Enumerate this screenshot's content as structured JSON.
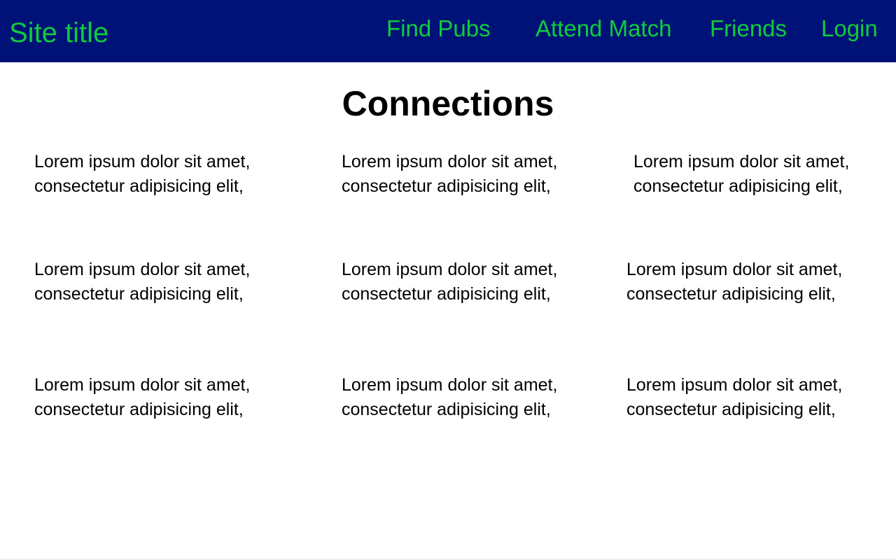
{
  "header": {
    "site_title": "Site title",
    "nav": [
      "Find Pubs",
      "Attend Match",
      "Friends",
      "Login"
    ]
  },
  "page": {
    "title": "Connections"
  },
  "connections": [
    {
      "line1": "Lorem ipsum dolor sit amet,",
      "line2": "consectetur adipisicing elit,"
    },
    {
      "line1": "Lorem ipsum dolor sit amet,",
      "line2": "consectetur adipisicing elit,"
    },
    {
      "line1": "Lorem ipsum dolor sit amet,",
      "line2": "consectetur adipisicing elit,"
    },
    {
      "line1": "Lorem ipsum dolor sit amet,",
      "line2": "consectetur adipisicing elit,"
    },
    {
      "line1": "Lorem ipsum dolor sit amet,",
      "line2": "consectetur adipisicing elit,"
    },
    {
      "line1": "Lorem ipsum dolor sit amet,",
      "line2": "consectetur adipisicing elit,"
    },
    {
      "line1": "Lorem ipsum dolor sit amet,",
      "line2": "consectetur adipisicing elit,"
    },
    {
      "line1": "Lorem ipsum dolor sit amet,",
      "line2": "consectetur adipisicing elit,"
    },
    {
      "line1": "Lorem ipsum dolor sit amet,",
      "line2": "consectetur adipisicing elit,"
    }
  ],
  "colors": {
    "header_bg": "#001277",
    "accent_text": "#0dcc3e",
    "body_text": "#000000",
    "page_bg": "#ffffff"
  }
}
